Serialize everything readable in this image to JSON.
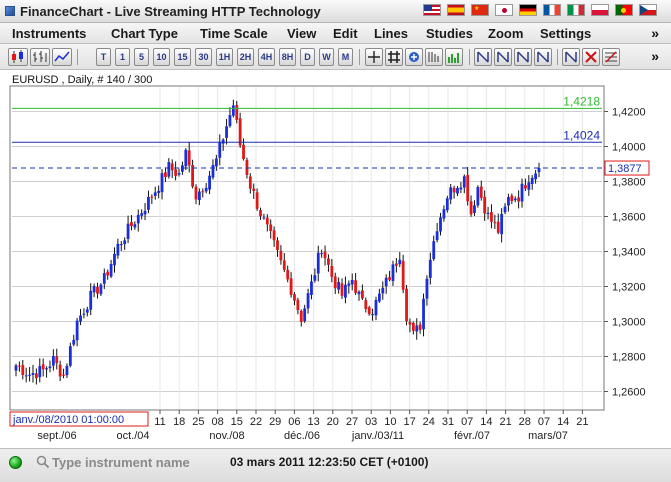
{
  "app": {
    "title": "FinanceChart - Live Streaming HTTP Technology",
    "languages": [
      "United States",
      "Spain",
      "China",
      "Japan",
      "Germany",
      "France",
      "Italy",
      "Poland",
      "Portugal",
      "Czech Republic"
    ]
  },
  "menu": {
    "items": [
      "Instruments",
      "Chart Type",
      "Time Scale",
      "View",
      "Edit",
      "Lines",
      "Studies",
      "Zoom",
      "Settings"
    ],
    "more": "»"
  },
  "toolbar": {
    "chart_type_icons": [
      "candlestick-icon",
      "bar-chart-icon",
      "line-chart-icon"
    ],
    "timescales": [
      "T",
      "1",
      "5",
      "10",
      "15",
      "30",
      "1H",
      "2H",
      "4H",
      "8H",
      "D",
      "W",
      "M"
    ],
    "line_tools": [
      "crosshair-icon",
      "grid-icon",
      "cursor-icon",
      "scale-icon",
      "volume-icon"
    ],
    "zoom_tools": [
      "zoom-1-icon",
      "zoom-2-icon",
      "zoom-3-icon",
      "zoom-4-icon",
      "zoom-5-icon",
      "zoom-6-icon",
      "zoom-7-icon",
      "zoom-8-icon"
    ],
    "edit_tools": [
      "edit-lines-icon",
      "delete-icon",
      "fibonacci-icon"
    ],
    "more": "»"
  },
  "chart": {
    "instrument_label": "EURUSD , Daily, # 140 / 300",
    "cursor_time_label": "janv./08/2010 01:00:00",
    "y_ticks": [
      "1,4200",
      "1,4000",
      "1,3800",
      "1,3600",
      "1,3400",
      "1,3200",
      "1,3000",
      "1,2800",
      "1,2600"
    ],
    "x_day_labels": [
      "11",
      "18",
      "25",
      "08",
      "15",
      "22",
      "29",
      "06",
      "13",
      "20",
      "27",
      "03",
      "10",
      "17",
      "24",
      "31",
      "07",
      "14",
      "21",
      "28",
      "07",
      "14",
      "21"
    ],
    "x_month_labels": [
      "sept./06",
      "oct./04",
      "nov./08",
      "déc./06",
      "janv./03/11",
      "févr./07",
      "mars/07"
    ],
    "lines": [
      {
        "label": "1,4218",
        "value": 1.4218,
        "color": "#2ebd2e"
      },
      {
        "label": "1,4024",
        "value": 1.4024,
        "color": "#1a2fb0"
      }
    ],
    "current_price_label": "1,3877",
    "current_price": 1.3877,
    "colors": {
      "up": "#1a2fd8",
      "down": "#e01818",
      "price_line": "#1a2fb0",
      "grid": "#cfcfcf"
    }
  },
  "chart_data": {
    "type": "candlestick",
    "title": "",
    "series_name": "EURUSD",
    "ylim": [
      1.25,
      1.434
    ],
    "y_ticks": [
      1.26,
      1.28,
      1.3,
      1.32,
      1.34,
      1.36,
      1.38,
      1.4,
      1.42
    ],
    "close_path": [
      [
        0,
        1.275
      ],
      [
        4,
        1.27
      ],
      [
        8,
        1.272
      ],
      [
        11,
        1.278
      ],
      [
        14,
        1.269
      ],
      [
        18,
        1.3
      ],
      [
        22,
        1.314
      ],
      [
        26,
        1.324
      ],
      [
        30,
        1.343
      ],
      [
        34,
        1.355
      ],
      [
        38,
        1.366
      ],
      [
        42,
        1.378
      ],
      [
        45,
        1.388
      ],
      [
        48,
        1.384
      ],
      [
        50,
        1.396
      ],
      [
        53,
        1.372
      ],
      [
        56,
        1.38
      ],
      [
        59,
        1.392
      ],
      [
        62,
        1.412
      ],
      [
        64,
        1.424
      ],
      [
        66,
        1.401
      ],
      [
        69,
        1.378
      ],
      [
        72,
        1.362
      ],
      [
        75,
        1.348
      ],
      [
        78,
        1.333
      ],
      [
        81,
        1.319
      ],
      [
        84,
        1.302
      ],
      [
        87,
        1.321
      ],
      [
        90,
        1.343
      ],
      [
        93,
        1.326
      ],
      [
        96,
        1.315
      ],
      [
        99,
        1.324
      ],
      [
        102,
        1.31
      ],
      [
        105,
        1.307
      ],
      [
        108,
        1.318
      ],
      [
        111,
        1.33
      ],
      [
        113,
        1.339
      ],
      [
        115,
        1.304
      ],
      [
        117,
        1.292
      ],
      [
        119,
        1.298
      ],
      [
        121,
        1.328
      ],
      [
        124,
        1.355
      ],
      [
        127,
        1.372
      ],
      [
        130,
        1.379
      ],
      [
        132,
        1.382
      ],
      [
        134,
        1.362
      ],
      [
        136,
        1.377
      ],
      [
        139,
        1.36
      ],
      [
        142,
        1.352
      ],
      [
        145,
        1.37
      ],
      [
        148,
        1.372
      ],
      [
        151,
        1.383
      ],
      [
        154,
        1.3877
      ]
    ],
    "reference_lines": [
      1.4218,
      1.4024
    ],
    "last_price": 1.3877
  },
  "status": {
    "search_placeholder": "Type instrument name",
    "clock": "03 mars 2011 12:23:50  CET (+0100)"
  }
}
